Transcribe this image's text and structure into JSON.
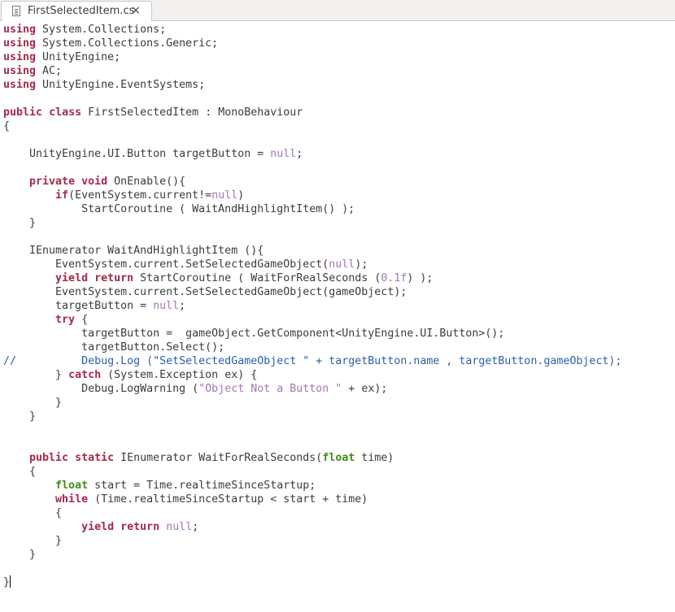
{
  "tab": {
    "title": "FirstSelectedItem.cs",
    "close_glyph": "×"
  },
  "code_lines": [
    [
      [
        "kw",
        "using"
      ],
      [
        "p",
        " System.Collections;"
      ]
    ],
    [
      [
        "kw",
        "using"
      ],
      [
        "p",
        " System.Collections.Generic;"
      ]
    ],
    [
      [
        "kw",
        "using"
      ],
      [
        "p",
        " UnityEngine;"
      ]
    ],
    [
      [
        "kw",
        "using"
      ],
      [
        "p",
        " AC;"
      ]
    ],
    [
      [
        "kw",
        "using"
      ],
      [
        "p",
        " UnityEngine.EventSystems;"
      ]
    ],
    [],
    [
      [
        "kw",
        "public"
      ],
      [
        "p",
        " "
      ],
      [
        "kw",
        "class"
      ],
      [
        "p",
        " FirstSelectedItem : MonoBehaviour"
      ]
    ],
    [
      [
        "p",
        "{"
      ]
    ],
    [],
    [
      [
        "p",
        "    UnityEngine.UI.Button targetButton = "
      ],
      [
        "nl",
        "null"
      ],
      [
        "p",
        ";"
      ]
    ],
    [],
    [
      [
        "p",
        "    "
      ],
      [
        "kw",
        "private"
      ],
      [
        "p",
        " "
      ],
      [
        "kw",
        "void"
      ],
      [
        "p",
        " OnEnable(){"
      ]
    ],
    [
      [
        "p",
        "        "
      ],
      [
        "kw",
        "if"
      ],
      [
        "p",
        "(EventSystem.current!="
      ],
      [
        "nl",
        "null"
      ],
      [
        "p",
        ")"
      ]
    ],
    [
      [
        "p",
        "            StartCoroutine ( WaitAndHighlightItem() );"
      ]
    ],
    [
      [
        "p",
        "    }"
      ]
    ],
    [],
    [
      [
        "p",
        "    IEnumerator WaitAndHighlightItem (){"
      ]
    ],
    [
      [
        "p",
        "        EventSystem.current.SetSelectedGameObject("
      ],
      [
        "nl",
        "null"
      ],
      [
        "p",
        ");"
      ]
    ],
    [
      [
        "p",
        "        "
      ],
      [
        "kw",
        "yield"
      ],
      [
        "p",
        " "
      ],
      [
        "kw",
        "return"
      ],
      [
        "p",
        " StartCoroutine ( WaitForRealSeconds ("
      ],
      [
        "nl",
        "0.1f"
      ],
      [
        "p",
        ") );"
      ]
    ],
    [
      [
        "p",
        "        EventSystem.current.SetSelectedGameObject(gameObject);"
      ]
    ],
    [
      [
        "p",
        "        targetButton = "
      ],
      [
        "nl",
        "null"
      ],
      [
        "p",
        ";"
      ]
    ],
    [
      [
        "p",
        "        "
      ],
      [
        "kw",
        "try"
      ],
      [
        "p",
        " {"
      ]
    ],
    [
      [
        "p",
        "            targetButton =  gameObject.GetComponent<UnityEngine.UI.Button>();"
      ]
    ],
    [
      [
        "p",
        "            targetButton.Select();"
      ]
    ],
    [
      [
        "cm",
        "//          Debug.Log (\"SetSelectedGameObject \" + targetButton.name , targetButton.gameObject);"
      ]
    ],
    [
      [
        "p",
        "        } "
      ],
      [
        "kw",
        "catch"
      ],
      [
        "p",
        " (System.Exception ex) {"
      ]
    ],
    [
      [
        "p",
        "            Debug.LogWarning ("
      ],
      [
        "st",
        "\"Object Not a Button \""
      ],
      [
        "p",
        " + ex);"
      ]
    ],
    [
      [
        "p",
        "        }"
      ]
    ],
    [
      [
        "p",
        "    }"
      ]
    ],
    [],
    [],
    [
      [
        "p",
        "    "
      ],
      [
        "kw",
        "public"
      ],
      [
        "p",
        " "
      ],
      [
        "kw",
        "static"
      ],
      [
        "p",
        " IEnumerator WaitForRealSeconds("
      ],
      [
        "ty",
        "float"
      ],
      [
        "p",
        " time)"
      ]
    ],
    [
      [
        "p",
        "    {"
      ]
    ],
    [
      [
        "p",
        "        "
      ],
      [
        "ty",
        "float"
      ],
      [
        "p",
        " start = Time.realtimeSinceStartup;"
      ]
    ],
    [
      [
        "p",
        "        "
      ],
      [
        "kw",
        "while"
      ],
      [
        "p",
        " (Time.realtimeSinceStartup < start + time)"
      ]
    ],
    [
      [
        "p",
        "        {"
      ]
    ],
    [
      [
        "p",
        "            "
      ],
      [
        "kw",
        "yield"
      ],
      [
        "p",
        " "
      ],
      [
        "kw",
        "return"
      ],
      [
        "p",
        " "
      ],
      [
        "nl",
        "null"
      ],
      [
        "p",
        ";"
      ]
    ],
    [
      [
        "p",
        "        }"
      ]
    ],
    [
      [
        "p",
        "    }"
      ]
    ],
    [],
    [
      [
        "p",
        "}"
      ]
    ]
  ],
  "colors": {
    "keyword": "#a52a48",
    "type": "#3e8f1a",
    "literal": "#a576b3",
    "comment": "#2b5fa8",
    "plain": "#3c3c3c"
  }
}
